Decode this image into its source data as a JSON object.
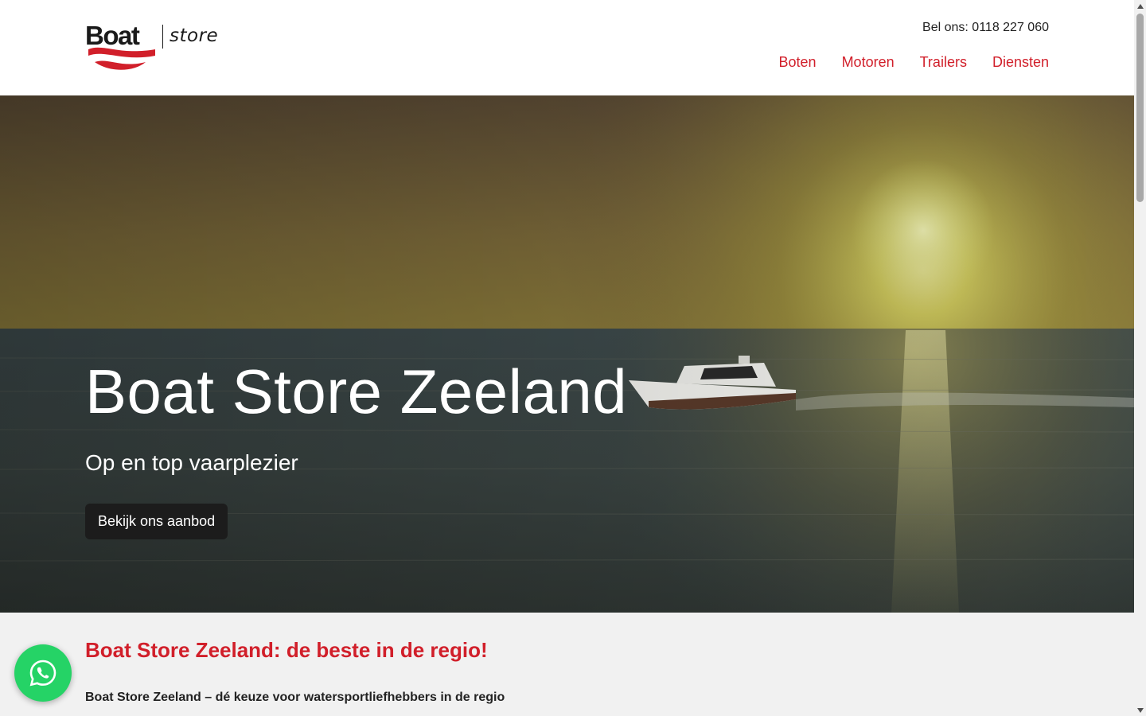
{
  "header": {
    "logo": {
      "boat_text": "Boat",
      "store_text": "store"
    },
    "phone_text": "Bel ons: 0118 227 060",
    "nav": [
      "Boten",
      "Motoren",
      "Trailers",
      "Diensten"
    ]
  },
  "hero": {
    "title": "Boat Store Zeeland",
    "subtitle": "Op en top vaarplezier",
    "cta_label": "Bekijk ons aanbod"
  },
  "content": {
    "heading": "Boat Store Zeeland: de beste in de regio!",
    "subheading": "Boat Store Zeeland – dé keuze voor watersportliefhebbers in de regio"
  },
  "colors": {
    "brand_red": "#d11f2a",
    "button_dark": "#1c1c1c",
    "whatsapp_green": "#25d366"
  },
  "icons": {
    "whatsapp": "whatsapp-icon",
    "scroll_up": "scroll-up-arrow-icon",
    "scroll_down": "scroll-down-arrow-icon"
  }
}
